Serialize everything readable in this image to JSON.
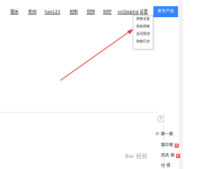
{
  "topnav": {
    "links": [
      "糯米",
      "新闻",
      "hao123",
      "地图",
      "视频",
      "贴吧"
    ],
    "username": "vviijieping",
    "settings": "设置",
    "more_products": "更多产品"
  },
  "settings_menu": {
    "items": [
      "搜索设置",
      "高级搜索",
      "关闭预测",
      "搜索历史"
    ]
  },
  "hot_panel": {
    "close_glyph": "×",
    "refresh_label": "换一换",
    "rows": [
      "案中案",
      "后风 格",
      "付 得"
    ],
    "badge": "新"
  },
  "watermark": "Bai 经验",
  "colors": {
    "accent": "#3385ff",
    "arrow": "#e03a3a",
    "badge": "#f54545"
  }
}
